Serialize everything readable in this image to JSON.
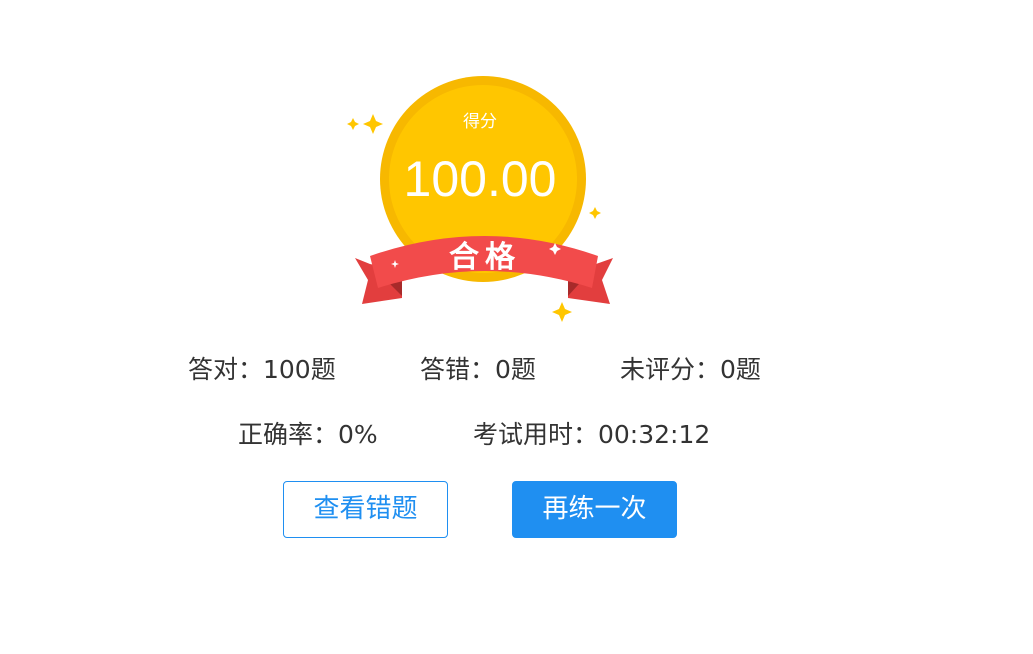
{
  "result": {
    "score_label": "得分",
    "score_value": "100.00",
    "pass_label": "合格"
  },
  "stats": {
    "correct": "答对：100题",
    "wrong": "答错：0题",
    "ungraded": "未评分：0题",
    "accuracy": "正确率：0%",
    "time_used": "考试用时：00:32:12"
  },
  "actions": {
    "review_label": "查看错题",
    "retry_label": "再练一次"
  },
  "colors": {
    "medal_gold": "#ffc600",
    "medal_rim": "#f7b800",
    "ribbon_red": "#f24b4b",
    "ribbon_dark": "#c93333",
    "sparkle": "#ffc600",
    "accent_blue": "#1f8ff1"
  }
}
